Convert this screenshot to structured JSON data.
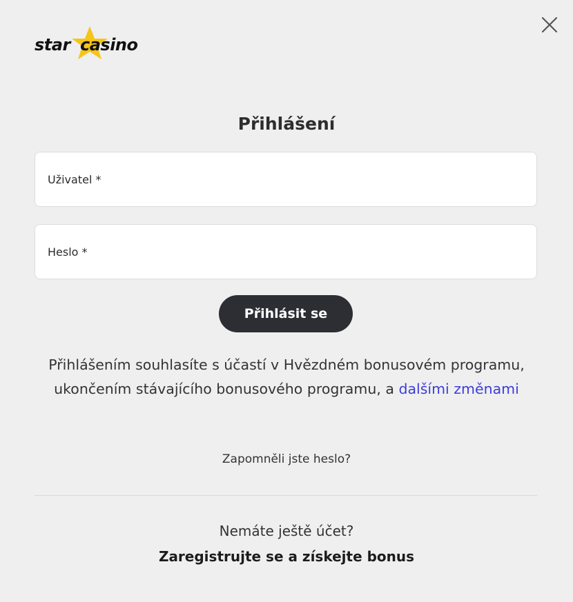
{
  "header": {
    "logo_left": "star",
    "logo_right": "casino",
    "close_icon": "close-icon",
    "logo_star_color": "#f5c518"
  },
  "login": {
    "title": "Přihlášení",
    "username_placeholder": "Uživatel *",
    "password_placeholder": "Heslo *",
    "submit_label": "Přihlásit se"
  },
  "consent": {
    "text": "Přihlášením souhlasíte s účastí v Hvězdném bonusovém programu, ukončením stávajícího bonusového programu, a ",
    "link_label": "dalšími změnami",
    "link_color": "#3c3cdc"
  },
  "forgot_password": "Zapomněli jste heslo?",
  "signup": {
    "prompt": "Nemáte ještě účet?",
    "cta": "Zaregistrujte se a získejte bonus"
  },
  "colors": {
    "background": "#efefef",
    "button_bg": "#2c2e33",
    "button_text": "#ffffff",
    "field_bg": "#ffffff"
  }
}
